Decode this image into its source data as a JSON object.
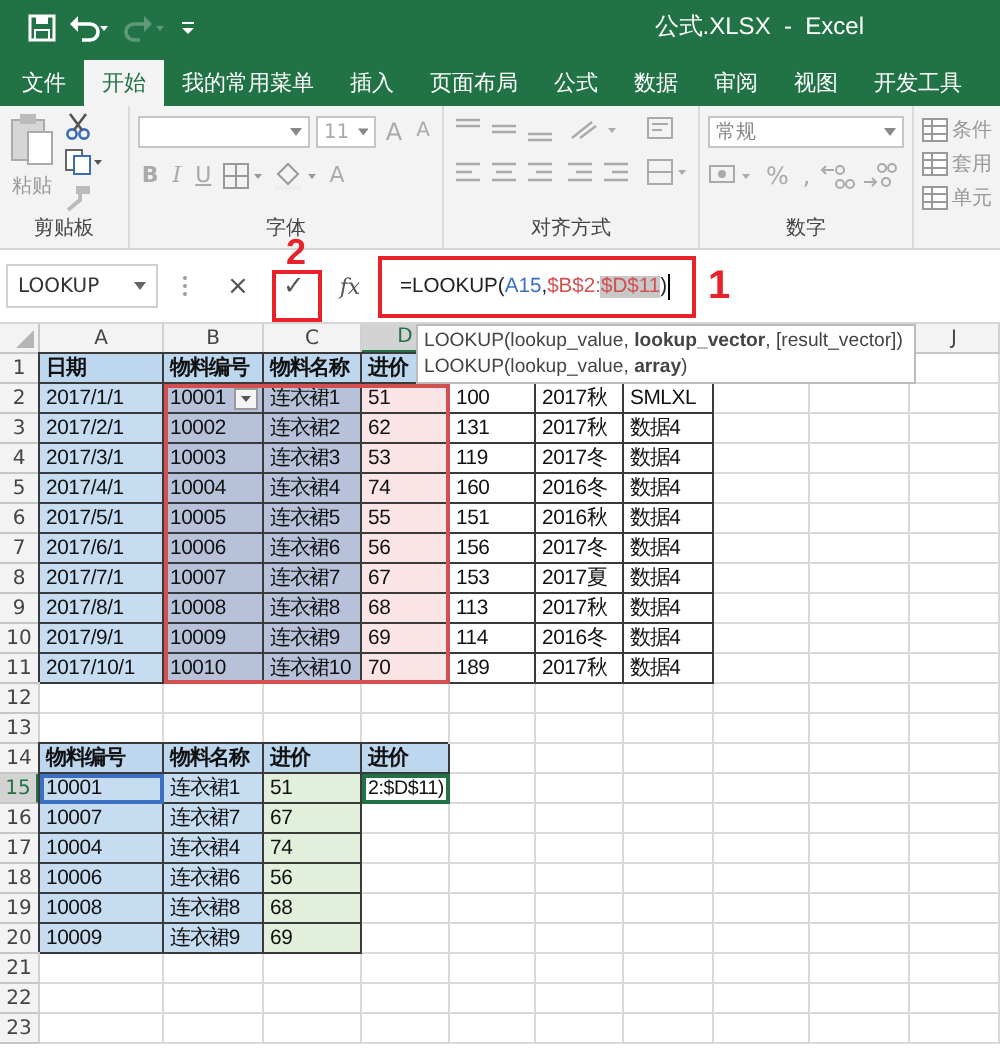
{
  "title_bar": {
    "title": "公式.XLSX  -  Excel"
  },
  "tabs": [
    {
      "label": "文件",
      "selected": false
    },
    {
      "label": "开始",
      "selected": true
    },
    {
      "label": "我的常用菜单",
      "selected": false
    },
    {
      "label": "插入",
      "selected": false
    },
    {
      "label": "页面布局",
      "selected": false
    },
    {
      "label": "公式",
      "selected": false
    },
    {
      "label": "数据",
      "selected": false
    },
    {
      "label": "审阅",
      "selected": false
    },
    {
      "label": "视图",
      "selected": false
    },
    {
      "label": "开发工具",
      "selected": false
    }
  ],
  "ribbon": {
    "groups": [
      "剪贴板",
      "字体",
      "对齐方式",
      "数字"
    ],
    "paste_label": "粘贴",
    "font_size": "11",
    "grow_letter": "A",
    "shrink_letter": "A",
    "style_letters": [
      "B",
      "I",
      "U"
    ],
    "font_color_letter": "A",
    "number_format": "常规",
    "percent": "%",
    "comma": ",",
    "styles": [
      "条件",
      "套用",
      "单元"
    ]
  },
  "formula_bar": {
    "name_box": "LOOKUP",
    "cancel": "×",
    "enter": "✓",
    "fx": "fx",
    "segments": [
      {
        "text": "=LOOKUP(",
        "kind": "plain"
      },
      {
        "text": "A15",
        "kind": "ref",
        "color": "#3a6fc4"
      },
      {
        "text": ",",
        "kind": "plain"
      },
      {
        "text": "$B$2:",
        "kind": "ref",
        "color": "#d2504f"
      },
      {
        "text": "$D$11",
        "kind": "highlight",
        "color": "#d2504f"
      },
      {
        "text": ")",
        "kind": "plain"
      }
    ]
  },
  "annotations": [
    {
      "label": "1"
    },
    {
      "label": "2"
    }
  ],
  "tooltip": [
    "LOOKUP(lookup_value, **lookup_vector**, [result_vector])",
    "LOOKUP(lookup_value, **array**)"
  ],
  "sheet": {
    "columns": [
      {
        "label": "A",
        "selected": false
      },
      {
        "label": "B",
        "selected": false
      },
      {
        "label": "C",
        "selected": false
      },
      {
        "label": "D",
        "selected": true
      },
      null,
      null,
      null,
      null,
      null,
      {
        "label": "J",
        "selected": false
      }
    ],
    "rows": [
      {
        "label": "1",
        "selected": false,
        "cells": [
          {
            "text": "日期",
            "kind": "header",
            "color": "#bdd7ee"
          },
          {
            "text": "物料编号",
            "kind": "header",
            "color": "#bdd7ee"
          },
          {
            "text": "物料名称",
            "kind": "header",
            "color": "#bdd7ee"
          },
          {
            "text": "进价",
            "kind": "header",
            "color": "#bdd7ee"
          }
        ]
      },
      {
        "label": "2",
        "selected": false,
        "cells": [
          {
            "text": "2017/1/1",
            "kind": "data",
            "color": "#c6dcf1"
          },
          {
            "text": "10001",
            "kind": "dropdown",
            "color": "#b7c2da",
            "reference": {
              "color": "#d2504f",
              "top": true,
              "bottom": false,
              "left": true,
              "right": false
            }
          },
          {
            "text": "连衣裙1",
            "kind": "data",
            "color": "#b7c2da",
            "reference": {
              "color": "#d2504f",
              "top": true,
              "bottom": false,
              "left": false,
              "right": false
            }
          },
          {
            "text": "51",
            "kind": "data",
            "color": "#fbe4e6",
            "reference": {
              "color": "#d2504f",
              "top": true,
              "bottom": false,
              "left": false,
              "right": true
            }
          },
          {
            "text": "100",
            "kind": "data",
            "color": "#ffffff"
          },
          {
            "text": "2017秋",
            "kind": "data",
            "color": "#ffffff"
          },
          {
            "text": "SMLXL",
            "kind": "data",
            "color": "#ffffff"
          }
        ]
      },
      {
        "label": "3",
        "selected": false,
        "cells": [
          {
            "text": "2017/2/1",
            "kind": "data",
            "color": "#c6dcf1"
          },
          {
            "text": "10002",
            "kind": "data",
            "color": "#b7c2da",
            "reference": {
              "color": "#d2504f",
              "top": false,
              "bottom": false,
              "left": true,
              "right": false
            }
          },
          {
            "text": "连衣裙2",
            "kind": "data",
            "color": "#b7c2da"
          },
          {
            "text": "62",
            "kind": "data",
            "color": "#fbe4e6",
            "reference": {
              "color": "#d2504f",
              "top": false,
              "bottom": false,
              "left": false,
              "right": true
            }
          },
          {
            "text": "131",
            "kind": "data",
            "color": "#ffffff"
          },
          {
            "text": "2017秋",
            "kind": "data",
            "color": "#ffffff"
          },
          {
            "text": "数据4",
            "kind": "data",
            "color": "#ffffff"
          }
        ]
      },
      {
        "label": "4",
        "selected": false,
        "cells": [
          {
            "text": "2017/3/1",
            "kind": "data",
            "color": "#c6dcf1"
          },
          {
            "text": "10003",
            "kind": "data",
            "color": "#b7c2da",
            "reference": {
              "color": "#d2504f",
              "top": false,
              "bottom": false,
              "left": true,
              "right": false
            }
          },
          {
            "text": "连衣裙3",
            "kind": "data",
            "color": "#b7c2da"
          },
          {
            "text": "53",
            "kind": "data",
            "color": "#fbe4e6",
            "reference": {
              "color": "#d2504f",
              "top": false,
              "bottom": false,
              "left": false,
              "right": true
            }
          },
          {
            "text": "119",
            "kind": "data",
            "color": "#ffffff"
          },
          {
            "text": "2017冬",
            "kind": "data",
            "color": "#ffffff"
          },
          {
            "text": "数据4",
            "kind": "data",
            "color": "#ffffff"
          }
        ]
      },
      {
        "label": "5",
        "selected": false,
        "cells": [
          {
            "text": "2017/4/1",
            "kind": "data",
            "color": "#c6dcf1"
          },
          {
            "text": "10004",
            "kind": "data",
            "color": "#b7c2da",
            "reference": {
              "color": "#d2504f",
              "top": false,
              "bottom": false,
              "left": true,
              "right": false
            }
          },
          {
            "text": "连衣裙4",
            "kind": "data",
            "color": "#b7c2da"
          },
          {
            "text": "74",
            "kind": "data",
            "color": "#fbe4e6",
            "reference": {
              "color": "#d2504f",
              "top": false,
              "bottom": false,
              "left": false,
              "right": true
            }
          },
          {
            "text": "160",
            "kind": "data",
            "color": "#ffffff"
          },
          {
            "text": "2016冬",
            "kind": "data",
            "color": "#ffffff"
          },
          {
            "text": "数据4",
            "kind": "data",
            "color": "#ffffff"
          }
        ]
      },
      {
        "label": "6",
        "selected": false,
        "cells": [
          {
            "text": "2017/5/1",
            "kind": "data",
            "color": "#c6dcf1"
          },
          {
            "text": "10005",
            "kind": "data",
            "color": "#b7c2da",
            "reference": {
              "color": "#d2504f",
              "top": false,
              "bottom": false,
              "left": true,
              "right": false
            }
          },
          {
            "text": "连衣裙5",
            "kind": "data",
            "color": "#b7c2da"
          },
          {
            "text": "55",
            "kind": "data",
            "color": "#fbe4e6",
            "reference": {
              "color": "#d2504f",
              "top": false,
              "bottom": false,
              "left": false,
              "right": true
            }
          },
          {
            "text": "151",
            "kind": "data",
            "color": "#ffffff"
          },
          {
            "text": "2016秋",
            "kind": "data",
            "color": "#ffffff"
          },
          {
            "text": "数据4",
            "kind": "data",
            "color": "#ffffff"
          }
        ]
      },
      {
        "label": "7",
        "selected": false,
        "cells": [
          {
            "text": "2017/6/1",
            "kind": "data",
            "color": "#c6dcf1"
          },
          {
            "text": "10006",
            "kind": "data",
            "color": "#b7c2da",
            "reference": {
              "color": "#d2504f",
              "top": false,
              "bottom": false,
              "left": true,
              "right": false
            }
          },
          {
            "text": "连衣裙6",
            "kind": "data",
            "color": "#b7c2da"
          },
          {
            "text": "56",
            "kind": "data",
            "color": "#fbe4e6",
            "reference": {
              "color": "#d2504f",
              "top": false,
              "bottom": false,
              "left": false,
              "right": true
            }
          },
          {
            "text": "156",
            "kind": "data",
            "color": "#ffffff"
          },
          {
            "text": "2017冬",
            "kind": "data",
            "color": "#ffffff"
          },
          {
            "text": "数据4",
            "kind": "data",
            "color": "#ffffff"
          }
        ]
      },
      {
        "label": "8",
        "selected": false,
        "cells": [
          {
            "text": "2017/7/1",
            "kind": "data",
            "color": "#c6dcf1"
          },
          {
            "text": "10007",
            "kind": "data",
            "color": "#b7c2da",
            "reference": {
              "color": "#d2504f",
              "top": false,
              "bottom": false,
              "left": true,
              "right": false
            }
          },
          {
            "text": "连衣裙7",
            "kind": "data",
            "color": "#b7c2da"
          },
          {
            "text": "67",
            "kind": "data",
            "color": "#fbe4e6",
            "reference": {
              "color": "#d2504f",
              "top": false,
              "bottom": false,
              "left": false,
              "right": true
            }
          },
          {
            "text": "153",
            "kind": "data",
            "color": "#ffffff"
          },
          {
            "text": "2017夏",
            "kind": "data",
            "color": "#ffffff"
          },
          {
            "text": "数据4",
            "kind": "data",
            "color": "#ffffff"
          }
        ]
      },
      {
        "label": "9",
        "selected": false,
        "cells": [
          {
            "text": "2017/8/1",
            "kind": "data",
            "color": "#c6dcf1"
          },
          {
            "text": "10008",
            "kind": "data",
            "color": "#b7c2da",
            "reference": {
              "color": "#d2504f",
              "top": false,
              "bottom": false,
              "left": true,
              "right": false
            }
          },
          {
            "text": "连衣裙8",
            "kind": "data",
            "color": "#b7c2da"
          },
          {
            "text": "68",
            "kind": "data",
            "color": "#fbe4e6",
            "reference": {
              "color": "#d2504f",
              "top": false,
              "bottom": false,
              "left": false,
              "right": true
            }
          },
          {
            "text": "113",
            "kind": "data",
            "color": "#ffffff"
          },
          {
            "text": "2017秋",
            "kind": "data",
            "color": "#ffffff"
          },
          {
            "text": "数据4",
            "kind": "data",
            "color": "#ffffff"
          }
        ]
      },
      {
        "label": "10",
        "selected": false,
        "cells": [
          {
            "text": "2017/9/1",
            "kind": "data",
            "color": "#c6dcf1"
          },
          {
            "text": "10009",
            "kind": "data",
            "color": "#b7c2da",
            "reference": {
              "color": "#d2504f",
              "top": false,
              "bottom": false,
              "left": true,
              "right": false
            }
          },
          {
            "text": "连衣裙9",
            "kind": "data",
            "color": "#b7c2da"
          },
          {
            "text": "69",
            "kind": "data",
            "color": "#fbe4e6",
            "reference": {
              "color": "#d2504f",
              "top": false,
              "bottom": false,
              "left": false,
              "right": true
            }
          },
          {
            "text": "114",
            "kind": "data",
            "color": "#ffffff"
          },
          {
            "text": "2016冬",
            "kind": "data",
            "color": "#ffffff"
          },
          {
            "text": "数据4",
            "kind": "data",
            "color": "#ffffff"
          }
        ]
      },
      {
        "label": "11",
        "selected": false,
        "cells": [
          {
            "text": "2017/10/1",
            "kind": "data",
            "color": "#c6dcf1"
          },
          {
            "text": "10010",
            "kind": "data",
            "color": "#b7c2da",
            "reference": {
              "color": "#d2504f",
              "top": false,
              "bottom": true,
              "left": true,
              "right": false
            }
          },
          {
            "text": "连衣裙10",
            "kind": "data",
            "color": "#b7c2da",
            "reference": {
              "color": "#d2504f",
              "top": false,
              "bottom": true,
              "left": false,
              "right": false
            }
          },
          {
            "text": "70",
            "kind": "data",
            "color": "#fbe4e6",
            "reference": {
              "color": "#d2504f",
              "top": false,
              "bottom": true,
              "left": false,
              "right": true
            }
          },
          {
            "text": "189",
            "kind": "data",
            "color": "#ffffff"
          },
          {
            "text": "2017秋",
            "kind": "data",
            "color": "#ffffff"
          },
          {
            "text": "数据4",
            "kind": "data",
            "color": "#ffffff"
          }
        ]
      },
      {
        "label": "12",
        "selected": false,
        "cells": []
      },
      {
        "label": "13",
        "selected": false,
        "cells": []
      },
      {
        "label": "14",
        "selected": false,
        "cells": [
          {
            "text": "物料编号",
            "kind": "header",
            "color": "#bdd7ee"
          },
          {
            "text": "物料名称",
            "kind": "header",
            "color": "#bdd7ee"
          },
          {
            "text": "进价",
            "kind": "header",
            "color": "#bdd7ee"
          },
          {
            "text": "进价",
            "kind": "header",
            "color": "#bdd7ee"
          }
        ]
      },
      {
        "label": "15",
        "selected": true,
        "cells": [
          {
            "text": "10001",
            "kind": "data",
            "color": "#c6dcf1",
            "reference": {
              "color": "#3a6fc4",
              "top": true,
              "bottom": true,
              "left": true,
              "right": true
            }
          },
          {
            "text": "连衣裙1",
            "kind": "data",
            "color": "#c6dcf1"
          },
          {
            "text": "51",
            "kind": "data",
            "color": "#e2efda"
          },
          {
            "text": "2:$D$11)",
            "kind": "data",
            "color": "#ffffff",
            "active": true
          }
        ]
      },
      {
        "label": "16",
        "selected": false,
        "cells": [
          {
            "text": "10007",
            "kind": "data",
            "color": "#c6dcf1"
          },
          {
            "text": "连衣裙7",
            "kind": "data",
            "color": "#c6dcf1"
          },
          {
            "text": "67",
            "kind": "data",
            "color": "#e2efda"
          }
        ]
      },
      {
        "label": "17",
        "selected": false,
        "cells": [
          {
            "text": "10004",
            "kind": "data",
            "color": "#c6dcf1"
          },
          {
            "text": "连衣裙4",
            "kind": "data",
            "color": "#c6dcf1"
          },
          {
            "text": "74",
            "kind": "data",
            "color": "#e2efda"
          }
        ]
      },
      {
        "label": "18",
        "selected": false,
        "cells": [
          {
            "text": "10006",
            "kind": "data",
            "color": "#c6dcf1"
          },
          {
            "text": "连衣裙6",
            "kind": "data",
            "color": "#c6dcf1"
          },
          {
            "text": "56",
            "kind": "data",
            "color": "#e2efda"
          }
        ]
      },
      {
        "label": "19",
        "selected": false,
        "cells": [
          {
            "text": "10008",
            "kind": "data",
            "color": "#c6dcf1"
          },
          {
            "text": "连衣裙8",
            "kind": "data",
            "color": "#c6dcf1"
          },
          {
            "text": "68",
            "kind": "data",
            "color": "#e2efda"
          }
        ]
      },
      {
        "label": "20",
        "selected": false,
        "cells": [
          {
            "text": "10009",
            "kind": "data",
            "color": "#c6dcf1"
          },
          {
            "text": "连衣裙9",
            "kind": "data",
            "color": "#c6dcf1"
          },
          {
            "text": "69",
            "kind": "data",
            "color": "#e2efda"
          }
        ]
      },
      {
        "label": "21",
        "selected": false,
        "cells": []
      },
      {
        "label": "22",
        "selected": false,
        "cells": []
      },
      {
        "label": "23",
        "selected": false,
        "cells": []
      }
    ]
  }
}
